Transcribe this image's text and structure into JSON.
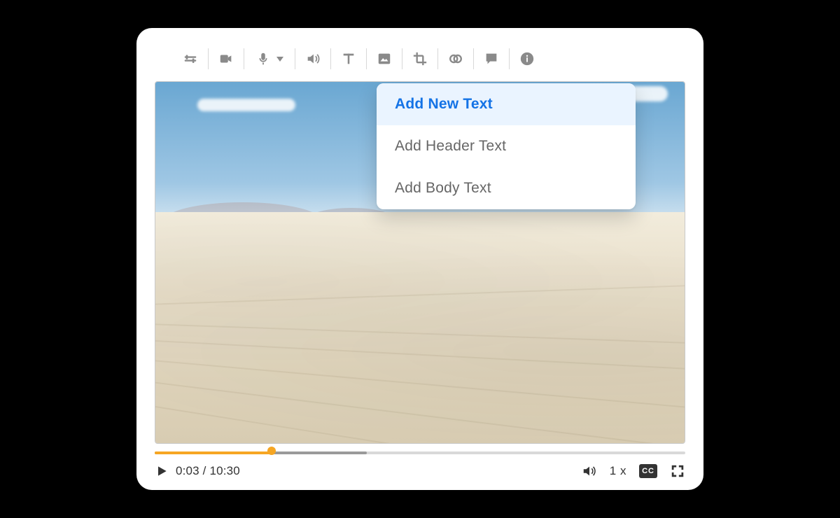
{
  "dropdown": {
    "items": [
      {
        "label": "Add New Text",
        "active": true
      },
      {
        "label": "Add Header Text",
        "active": false
      },
      {
        "label": "Add Body Text",
        "active": false
      }
    ]
  },
  "playback": {
    "current": "0:03",
    "total": "10:30",
    "time_display": "0:03 / 10:30",
    "speed": "1 x",
    "cc_label": "CC",
    "played_pct": 22,
    "buffered_pct": 40
  },
  "colors": {
    "accent_orange": "#f6a623",
    "accent_blue": "#1473e6",
    "highlight_bg": "#eaf4ff",
    "icon_gray": "#8a8a8a"
  },
  "toolbar": {
    "items": [
      "slider-tool",
      "camera-tool",
      "microphone-tool",
      "camera-tool",
      "volume-tool",
      "text-tool",
      "media-tool",
      "crop-tool",
      "loop-tool",
      "comment-tool",
      "info-tool"
    ]
  }
}
